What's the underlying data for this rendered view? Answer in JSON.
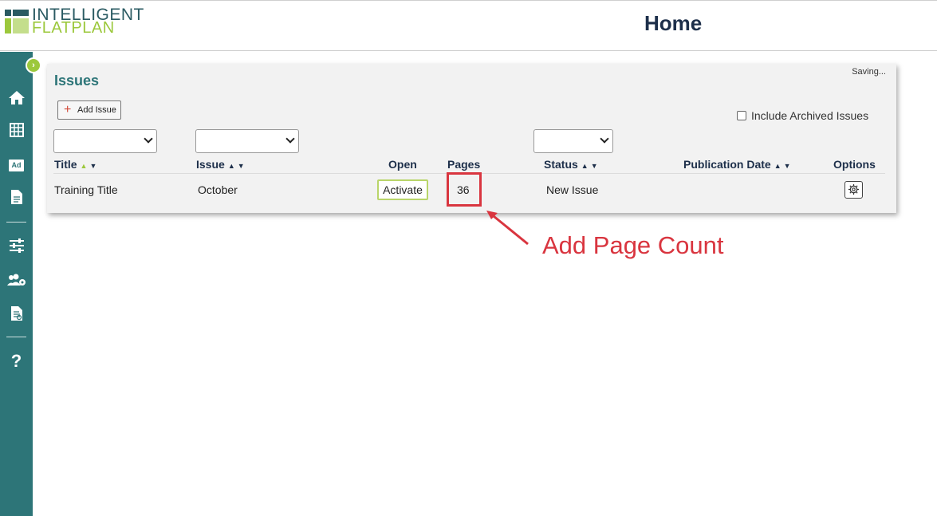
{
  "header": {
    "logo_line1": "INTELLIGENT",
    "logo_line2": "FLATPLAN",
    "title": "Home"
  },
  "sidebar": {
    "toggle_glyph": "›",
    "items": [
      {
        "icon": "home-icon"
      },
      {
        "icon": "flatplan-grid-icon"
      },
      {
        "icon": "ad-icon",
        "label": "Ad"
      },
      {
        "icon": "document-icon"
      },
      {
        "icon": "settings-sliders-icon"
      },
      {
        "icon": "users-gear-icon"
      },
      {
        "icon": "report-icon"
      },
      {
        "icon": "help-icon",
        "label": "?"
      }
    ]
  },
  "issues_panel": {
    "title": "Issues",
    "status_text": "Saving...",
    "add_button": "Add Issue",
    "include_archived_label": "Include Archived Issues",
    "include_archived_checked": false,
    "columns": [
      "Title",
      "Issue",
      "Open",
      "Pages",
      "Status",
      "Publication Date",
      "Options"
    ],
    "rows": [
      {
        "title": "Training Title",
        "issue": "October",
        "open_action": "Activate",
        "pages": "36",
        "status": "New Issue",
        "publication_date": ""
      }
    ]
  },
  "annotation": {
    "text": "Add Page Count"
  },
  "colors": {
    "brand_teal": "#2d7578",
    "brand_green": "#9cc83c",
    "heading_navy": "#1d2f4a",
    "annotation_red": "#d9353f"
  }
}
